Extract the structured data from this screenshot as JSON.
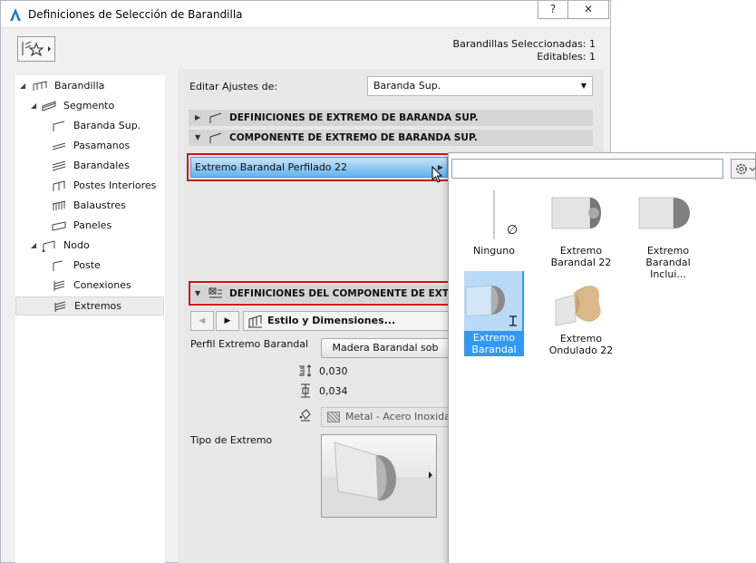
{
  "window": {
    "title": "Definiciones de Selección de Barandilla",
    "help_label": "?",
    "close_label": "✕"
  },
  "selection_info": {
    "line1": "Barandillas Seleccionadas: 1",
    "line2": "Editables: 1"
  },
  "tree": {
    "items": [
      {
        "label": "Barandilla",
        "level": 0,
        "expanded": true
      },
      {
        "label": "Segmento",
        "level": 1,
        "expanded": true
      },
      {
        "label": "Baranda Sup.",
        "level": 2
      },
      {
        "label": "Pasamanos",
        "level": 2
      },
      {
        "label": "Barandales",
        "level": 2
      },
      {
        "label": "Postes Interiores",
        "level": 2
      },
      {
        "label": "Balaustres",
        "level": 2
      },
      {
        "label": "Paneles",
        "level": 2
      },
      {
        "label": "Nodo",
        "level": 1,
        "expanded": true
      },
      {
        "label": "Poste",
        "level": 2
      },
      {
        "label": "Conexiones",
        "level": 2
      },
      {
        "label": "Extremos",
        "level": 2,
        "selected": true
      }
    ]
  },
  "main": {
    "edit_label": "Editar Ajustes de:",
    "edit_value": "Baranda Sup.",
    "section1": "DEFINICIONES DE EXTREMO DE BARANDA SUP.",
    "section2": "COMPONENTE DE EXTREMO DE BARANDA SUP.",
    "component_selected": "Extremo Barandal Perfilado 22",
    "section3": "DEFINICIONES DEL COMPONENTE DE EXTREM",
    "page_label": "Estilo y Dimensiones...",
    "profile_label": "Perfil Extremo Barandal",
    "profile_value": "Madera Barandal sob",
    "dim1": "0,030",
    "dim2": "0,034",
    "material": "Metal - Acero Inoxidab",
    "end_type_label": "Tipo de Extremo"
  },
  "popup": {
    "search_placeholder": "",
    "tiles": [
      {
        "label": "Ninguno",
        "glyph": "∅"
      },
      {
        "label": "Extremo Barandal 22"
      },
      {
        "label": "Extremo Barandal Inclui..."
      },
      {
        "label": "Extremo Barandal Perfil...",
        "selected": true
      },
      {
        "label": "Extremo Ondulado 22"
      }
    ]
  },
  "colors": {
    "accent_blue": "#3299f2",
    "highlight_red": "#d01010"
  }
}
